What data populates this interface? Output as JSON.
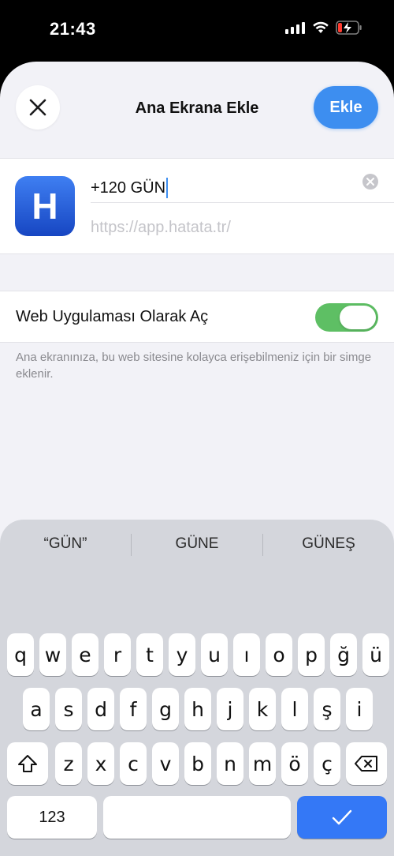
{
  "status": {
    "time": "21:43"
  },
  "nav": {
    "title": "Ana Ekrana Ekle",
    "add_label": "Ekle"
  },
  "form": {
    "app_icon_letter": "H",
    "name_value": "+120 GÜN",
    "url_value": "https://app.hatata.tr/"
  },
  "toggle_row": {
    "label": "Web Uygulaması Olarak Aç",
    "on": true
  },
  "footnote": "Ana ekranınıza, bu web sitesine kolayca erişebilmeniz için bir simge eklenir.",
  "keyboard": {
    "suggestions": [
      "“GÜN”",
      "GÜNE",
      "GÜNEŞ"
    ],
    "row1": [
      "q",
      "w",
      "e",
      "r",
      "t",
      "y",
      "u",
      "ı",
      "o",
      "p",
      "ğ",
      "ü"
    ],
    "row2": [
      "a",
      "s",
      "d",
      "f",
      "g",
      "h",
      "j",
      "k",
      "l",
      "ş",
      "i"
    ],
    "row3": [
      "z",
      "x",
      "c",
      "v",
      "b",
      "n",
      "m",
      "ö",
      "ç"
    ],
    "numbers_label": "123",
    "done_label": "✓"
  },
  "colors": {
    "accent": "#3d8ef0",
    "toggle_on": "#5ebf64",
    "keyboard_bg": "#d4d6dc"
  }
}
